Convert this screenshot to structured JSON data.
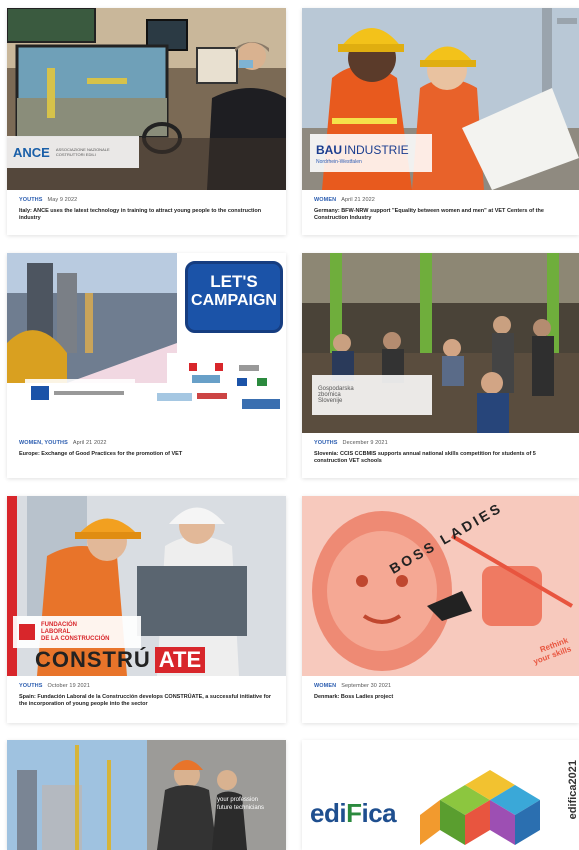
{
  "cards": [
    {
      "tag": "YOUTHS",
      "date": "May 9 2022",
      "title": "Italy: ANCE uses the latest technology in training to attract young people to the construction industry",
      "logo": {
        "word": "ANCE",
        "sub": "ASSOCIAZIONE NAZIONALE COSTRUTTORI EDILI"
      }
    },
    {
      "tag": "WOMEN",
      "date": "April 21 2022",
      "title": "Germany: BFW-NRW support \"Equality between women and men\" at VET Centers of the Construction Industry",
      "logo": {
        "word_a": "BAU",
        "word_b": "INDUSTRIE",
        "sub": "Nordrhein-Westfalen"
      }
    },
    {
      "tag": "WOMEN, YOUTHS",
      "date": "April 21 2022",
      "title": "Europe: Exchange of Good Practices for the promotion of VET",
      "logo": {
        "line1": "LET'S",
        "line2": "CAMPAIGN"
      }
    },
    {
      "tag": "YOUTHS",
      "date": "December 9 2021",
      "title": "Slovenia: CCIS CCBMIS supports annual national skills competition for students of 5 construction VET schools",
      "logo": {
        "line1": "Gospodarska",
        "line2": "zbornica",
        "line3": "Slovenije"
      }
    },
    {
      "tag": "YOUTHS",
      "date": "October 19 2021",
      "title": "Spain: Fundación Laboral de la Construcción develops CONSTRÚATE, a successful initiative for the incorporation of young people into the sector",
      "logo": {
        "line1": "FUNDACIÓN",
        "line2": "LABORAL",
        "line3": "DE LA CONSTRUCCIÓN",
        "word_a": "CONSTRÚ",
        "word_b": "ATE"
      }
    },
    {
      "tag": "WOMEN",
      "date": "September 30 2021",
      "title": "Denmark: Boss Ladies project",
      "logo": {
        "line1": "BOSS LADIES",
        "line2": "Rethink",
        "line3": "your skills"
      }
    },
    {
      "tag": "",
      "date": "",
      "title": "",
      "logo": {
        "line1": "your profession",
        "line2": "future technicians"
      }
    },
    {
      "tag": "",
      "date": "",
      "title": "",
      "logo": {
        "word_a": "edi",
        "word_b": "F",
        "word_c": "ica",
        "side": "edifica2021"
      }
    }
  ],
  "colors": {
    "tag": "#2b5db0",
    "ance": "#1a5fa8",
    "bau": "#1a3d8f",
    "campaign": "#1b53a8",
    "construate_red": "#d8262b",
    "boss_bg": "#f7c9bd",
    "boss_ink": "#e8553f"
  }
}
